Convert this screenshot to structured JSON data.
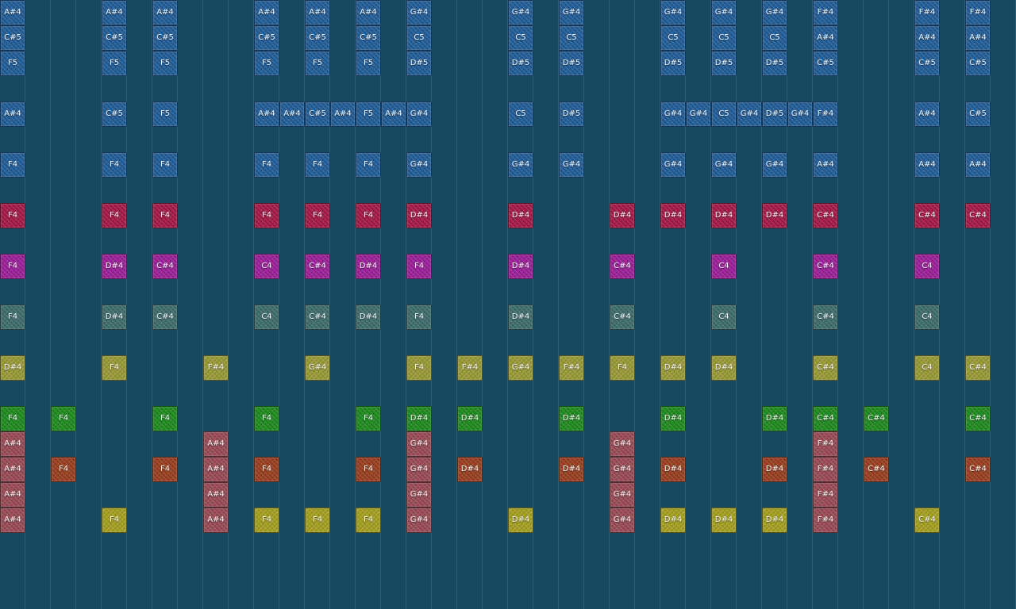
{
  "palette": {
    "blue": "#1f5c98",
    "crimson": "#a51846",
    "magenta": "#9c1e9a",
    "teal": "#3d6c6c",
    "olive": "#9a9a36",
    "green": "#1e8a1e",
    "rose": "#9a4a55",
    "rust": "#9a3e1e",
    "yellow": "#a5a01e"
  },
  "rows": [
    {
      "color": "blue",
      "notes": [
        [
          0,
          "A#4"
        ],
        [
          4,
          "A#4"
        ],
        [
          6,
          "A#4"
        ],
        [
          10,
          "A#4"
        ],
        [
          12,
          "A#4"
        ],
        [
          14,
          "A#4"
        ],
        [
          16,
          "G#4"
        ],
        [
          20,
          "G#4"
        ],
        [
          22,
          "G#4"
        ],
        [
          26,
          "G#4"
        ],
        [
          28,
          "G#4"
        ],
        [
          30,
          "G#4"
        ],
        [
          32,
          "F#4"
        ],
        [
          36,
          "F#4"
        ],
        [
          38,
          "F#4"
        ]
      ]
    },
    {
      "color": "blue",
      "notes": [
        [
          0,
          "C#5"
        ],
        [
          4,
          "C#5"
        ],
        [
          6,
          "C#5"
        ],
        [
          10,
          "C#5"
        ],
        [
          12,
          "C#5"
        ],
        [
          14,
          "C#5"
        ],
        [
          16,
          "C5"
        ],
        [
          20,
          "C5"
        ],
        [
          22,
          "C5"
        ],
        [
          26,
          "C5"
        ],
        [
          28,
          "C5"
        ],
        [
          30,
          "C5"
        ],
        [
          32,
          "A#4"
        ],
        [
          36,
          "A#4"
        ],
        [
          38,
          "A#4"
        ]
      ]
    },
    {
      "color": "blue",
      "notes": [
        [
          0,
          "F5"
        ],
        [
          4,
          "F5"
        ],
        [
          6,
          "F5"
        ],
        [
          10,
          "F5"
        ],
        [
          12,
          "F5"
        ],
        [
          14,
          "F5"
        ],
        [
          16,
          "D#5"
        ],
        [
          20,
          "D#5"
        ],
        [
          22,
          "D#5"
        ],
        [
          26,
          "D#5"
        ],
        [
          28,
          "D#5"
        ],
        [
          30,
          "D#5"
        ],
        [
          32,
          "C#5"
        ],
        [
          36,
          "C#5"
        ],
        [
          38,
          "C#5"
        ]
      ]
    },
    {
      "color": "blue",
      "notes": []
    },
    {
      "color": "blue",
      "notes": [
        [
          0,
          "A#4"
        ],
        [
          4,
          "C#5"
        ],
        [
          6,
          "F5"
        ],
        [
          10,
          "A#4"
        ],
        [
          11,
          "A#4"
        ],
        [
          12,
          "C#5"
        ],
        [
          13,
          "A#4"
        ],
        [
          14,
          "F5"
        ],
        [
          15,
          "A#4"
        ],
        [
          16,
          "G#4"
        ],
        [
          20,
          "C5"
        ],
        [
          22,
          "D#5"
        ],
        [
          26,
          "G#4"
        ],
        [
          27,
          "G#4"
        ],
        [
          28,
          "C5"
        ],
        [
          29,
          "G#4"
        ],
        [
          30,
          "D#5"
        ],
        [
          31,
          "G#4"
        ],
        [
          32,
          "F#4"
        ],
        [
          36,
          "A#4"
        ],
        [
          38,
          "C#5"
        ]
      ]
    },
    {
      "color": "blue",
      "notes": []
    },
    {
      "color": "blue",
      "notes": [
        [
          0,
          "F4"
        ],
        [
          4,
          "F4"
        ],
        [
          6,
          "F4"
        ],
        [
          10,
          "F4"
        ],
        [
          12,
          "F4"
        ],
        [
          14,
          "F4"
        ],
        [
          16,
          "G#4"
        ],
        [
          20,
          "G#4"
        ],
        [
          22,
          "G#4"
        ],
        [
          26,
          "G#4"
        ],
        [
          28,
          "G#4"
        ],
        [
          30,
          "G#4"
        ],
        [
          32,
          "A#4"
        ],
        [
          36,
          "A#4"
        ],
        [
          38,
          "A#4"
        ]
      ]
    },
    {
      "color": "crimson",
      "notes": []
    },
    {
      "color": "crimson",
      "notes": [
        [
          0,
          "F4"
        ],
        [
          4,
          "F4"
        ],
        [
          6,
          "F4"
        ],
        [
          10,
          "F4"
        ],
        [
          12,
          "F4"
        ],
        [
          14,
          "F4"
        ],
        [
          16,
          "D#4"
        ],
        [
          20,
          "D#4"
        ],
        [
          24,
          "D#4"
        ],
        [
          26,
          "D#4"
        ],
        [
          28,
          "D#4"
        ],
        [
          30,
          "D#4"
        ],
        [
          32,
          "C#4"
        ],
        [
          36,
          "C#4"
        ],
        [
          38,
          "C#4"
        ]
      ]
    },
    {
      "color": "magenta",
      "notes": []
    },
    {
      "color": "magenta",
      "notes": [
        [
          0,
          "F4"
        ],
        [
          4,
          "D#4"
        ],
        [
          6,
          "C#4"
        ],
        [
          10,
          "C4"
        ],
        [
          12,
          "C#4"
        ],
        [
          14,
          "D#4"
        ],
        [
          16,
          "F4"
        ],
        [
          20,
          "D#4"
        ],
        [
          24,
          "C#4"
        ],
        [
          28,
          "C4"
        ],
        [
          32,
          "C#4"
        ],
        [
          36,
          "C4"
        ]
      ]
    },
    {
      "color": "teal",
      "notes": []
    },
    {
      "color": "teal",
      "notes": [
        [
          0,
          "F4"
        ],
        [
          4,
          "D#4"
        ],
        [
          6,
          "C#4"
        ],
        [
          10,
          "C4"
        ],
        [
          12,
          "C#4"
        ],
        [
          14,
          "D#4"
        ],
        [
          16,
          "F4"
        ],
        [
          20,
          "D#4"
        ],
        [
          24,
          "C#4"
        ],
        [
          28,
          "C4"
        ],
        [
          32,
          "C#4"
        ],
        [
          36,
          "C4"
        ]
      ]
    },
    {
      "color": "olive",
      "notes": []
    },
    {
      "color": "olive",
      "notes": [
        [
          0,
          "D#4"
        ],
        [
          4,
          "F4"
        ],
        [
          8,
          "F#4"
        ],
        [
          12,
          "G#4"
        ],
        [
          16,
          "F4"
        ],
        [
          18,
          "F#4"
        ],
        [
          20,
          "G#4"
        ],
        [
          22,
          "F#4"
        ],
        [
          24,
          "F4"
        ],
        [
          26,
          "D#4"
        ],
        [
          28,
          "D#4"
        ],
        [
          32,
          "C#4"
        ],
        [
          36,
          "C4"
        ],
        [
          38,
          "C#4"
        ]
      ]
    },
    {
      "color": "green",
      "notes": []
    },
    {
      "color": "green",
      "notes": [
        [
          0,
          "F4"
        ],
        [
          2,
          "F4"
        ],
        [
          6,
          "F4"
        ],
        [
          10,
          "F4"
        ],
        [
          14,
          "F4"
        ],
        [
          16,
          "D#4"
        ],
        [
          18,
          "D#4"
        ],
        [
          22,
          "D#4"
        ],
        [
          26,
          "D#4"
        ],
        [
          30,
          "D#4"
        ],
        [
          32,
          "C#4"
        ],
        [
          34,
          "C#4"
        ],
        [
          38,
          "C#4"
        ]
      ]
    },
    {
      "color": "rose",
      "notes": [
        [
          0,
          "A#4"
        ],
        [
          8,
          "A#4"
        ],
        [
          16,
          "G#4"
        ],
        [
          24,
          "G#4"
        ],
        [
          32,
          "F#4"
        ]
      ]
    },
    {
      "color": "rust",
      "notes": [
        [
          0,
          "A#4"
        ],
        [
          2,
          "F4"
        ],
        [
          6,
          "F4"
        ],
        [
          8,
          "A#4"
        ],
        [
          10,
          "F4"
        ],
        [
          14,
          "F4"
        ],
        [
          16,
          "G#4"
        ],
        [
          18,
          "D#4"
        ],
        [
          22,
          "D#4"
        ],
        [
          24,
          "G#4"
        ],
        [
          26,
          "D#4"
        ],
        [
          30,
          "D#4"
        ],
        [
          32,
          "F#4"
        ],
        [
          34,
          "C#4"
        ],
        [
          38,
          "C#4"
        ]
      ]
    },
    {
      "color": "rose",
      "notes": [
        [
          0,
          "A#4"
        ],
        [
          8,
          "A#4"
        ],
        [
          16,
          "G#4"
        ],
        [
          24,
          "G#4"
        ],
        [
          32,
          "F#4"
        ]
      ]
    },
    {
      "color": "yellow",
      "notes": [
        [
          0,
          "A#4"
        ],
        [
          4,
          "F4"
        ],
        [
          8,
          "A#4"
        ],
        [
          10,
          "F4"
        ],
        [
          12,
          "F4"
        ],
        [
          14,
          "F4"
        ],
        [
          16,
          "G#4"
        ],
        [
          20,
          "D#4"
        ],
        [
          24,
          "G#4"
        ],
        [
          26,
          "D#4"
        ],
        [
          28,
          "D#4"
        ],
        [
          30,
          "D#4"
        ],
        [
          32,
          "F#4"
        ],
        [
          36,
          "C#4"
        ]
      ]
    }
  ]
}
